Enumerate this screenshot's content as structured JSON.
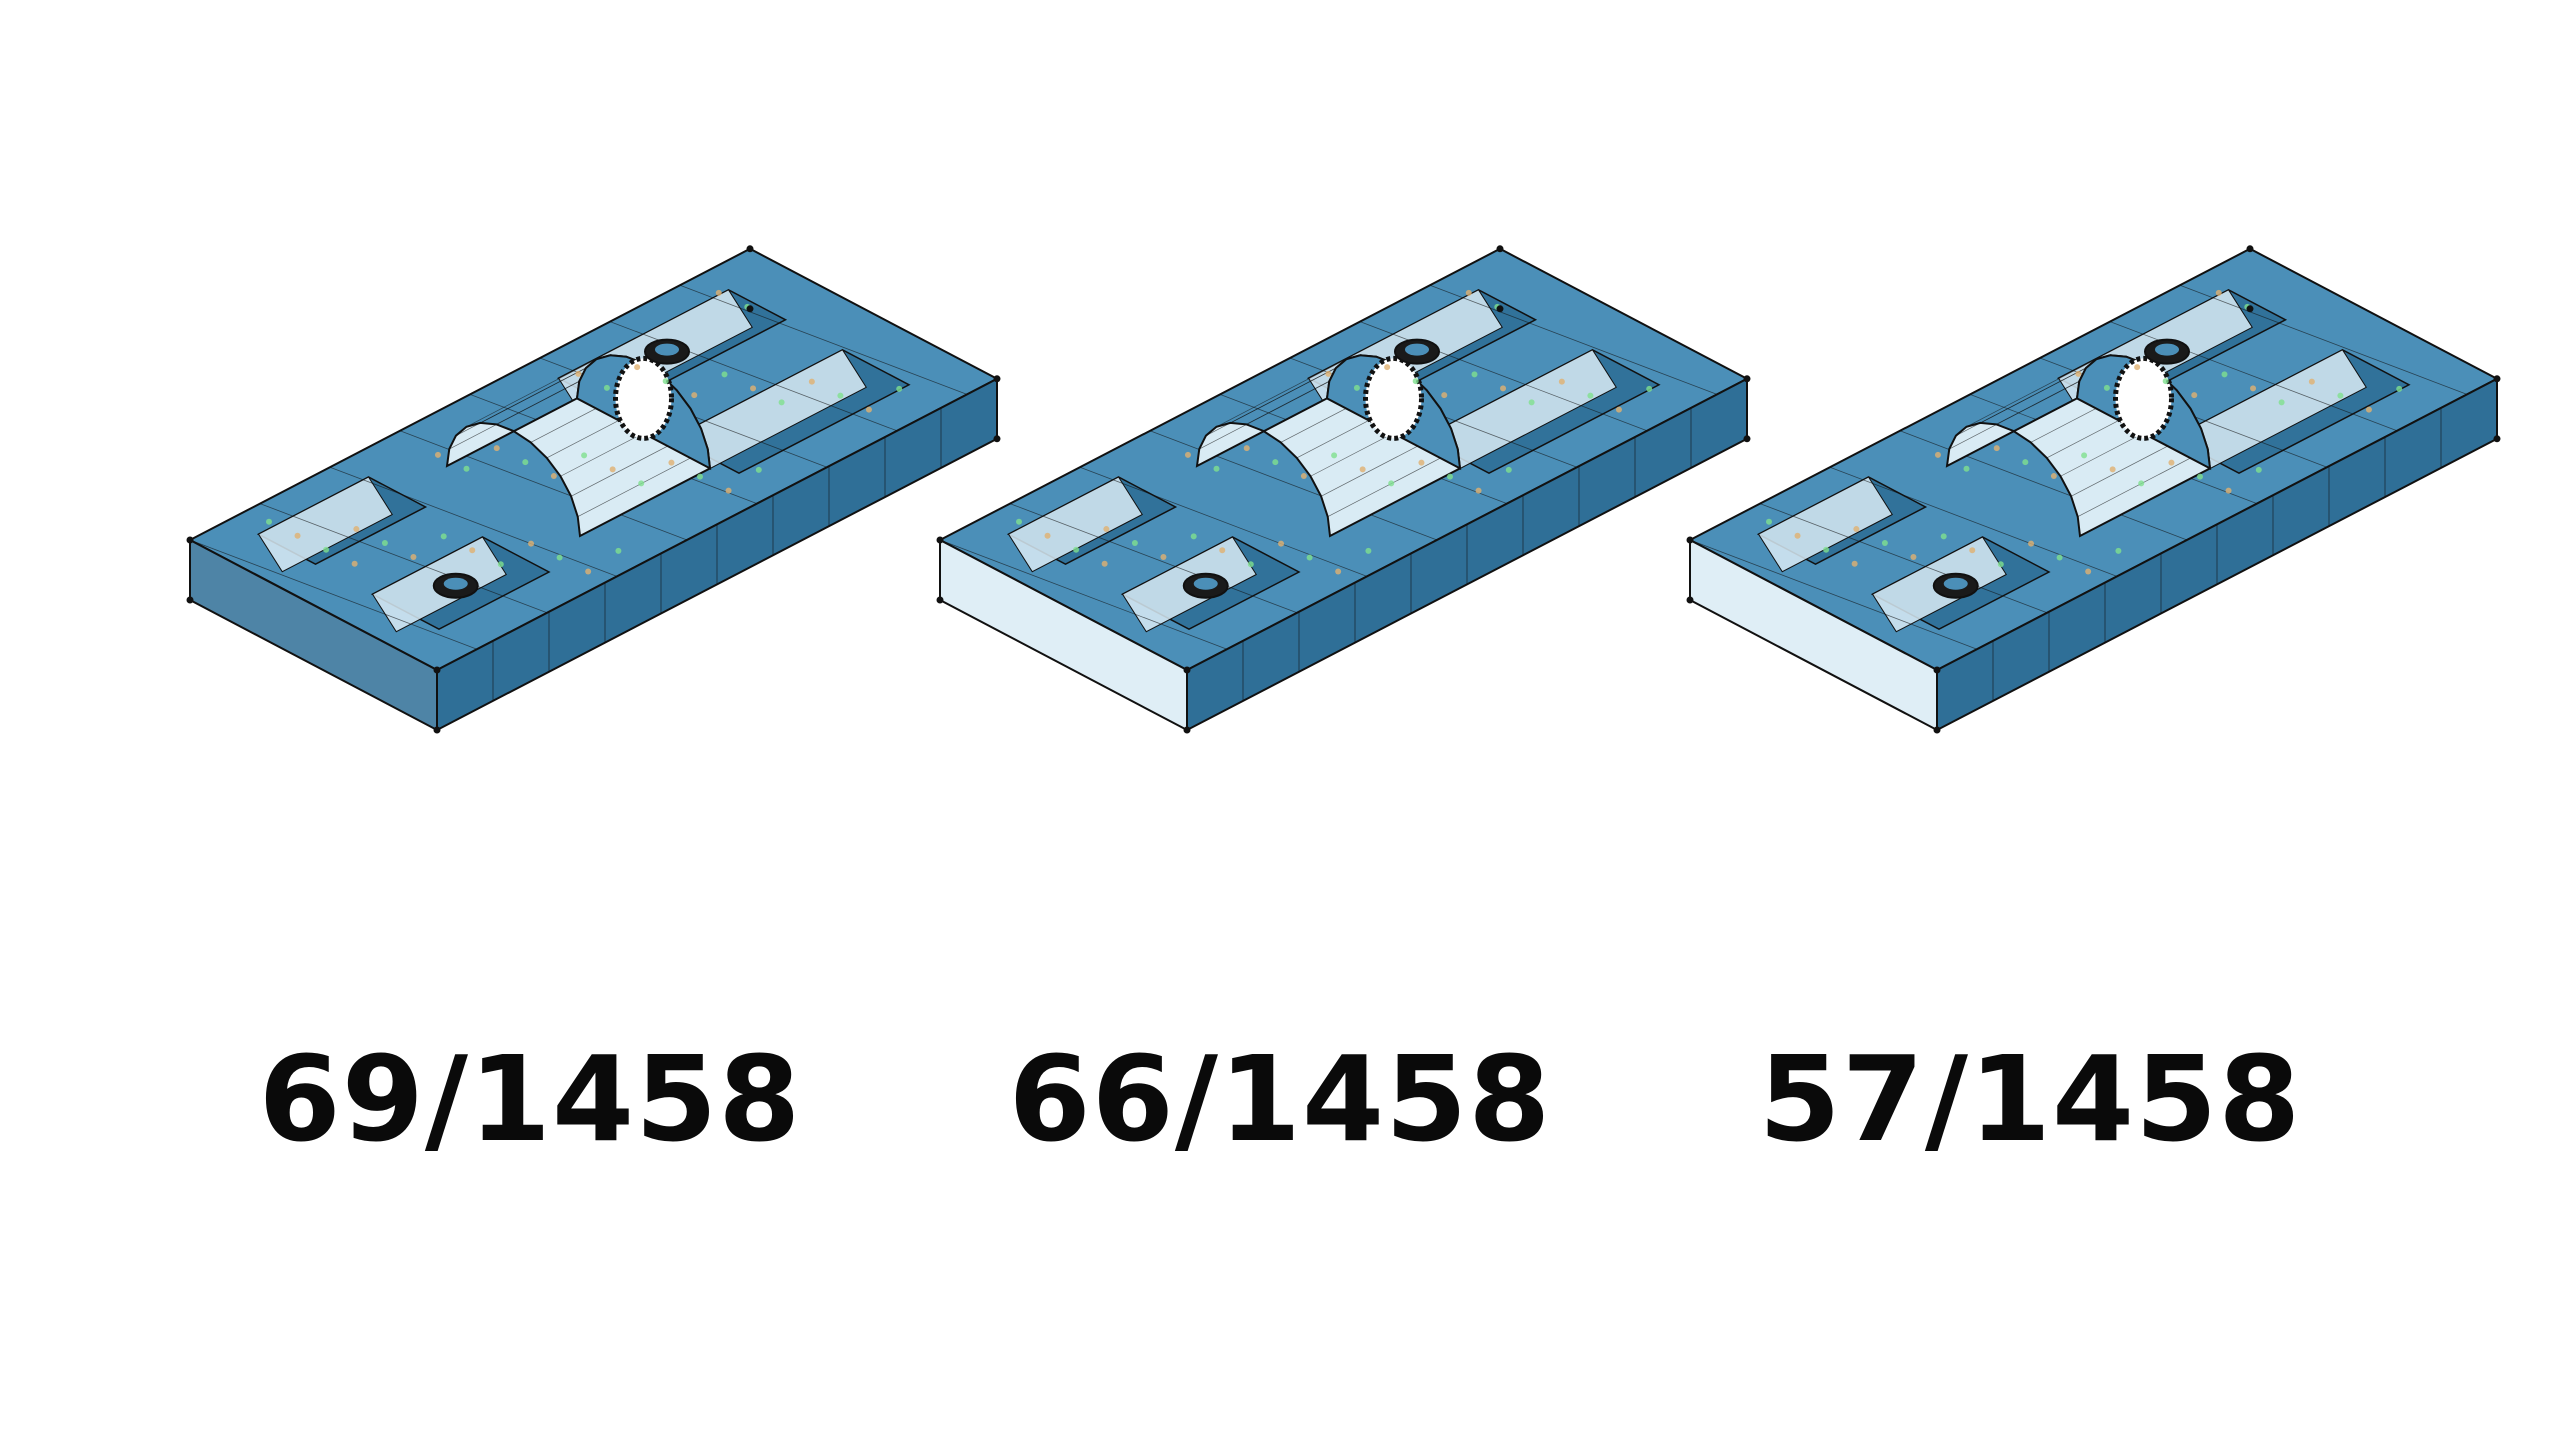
{
  "panels": [
    {
      "id": "panel-1",
      "label": "69/1458"
    },
    {
      "id": "panel-2",
      "label": "66/1458"
    },
    {
      "id": "panel-3",
      "label": "57/1458"
    }
  ],
  "colors": {
    "mesh_fill_dark": "#2f6f97",
    "mesh_fill_mid": "#4b8fb8",
    "mesh_fill_light": "#d9ebf4",
    "edge": "#111111",
    "point_orange": "#e0b070",
    "point_green": "#7fe08f"
  }
}
